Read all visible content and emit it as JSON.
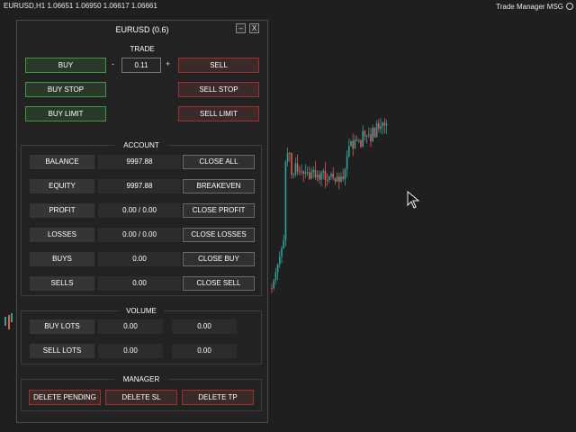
{
  "topbar": {
    "symbol_line": "EURUSD,H1  1.06651 1.06950 1.06617 1.06661",
    "right_label": "Trade Manager MSG"
  },
  "panel": {
    "title": "EURUSD (0.6)",
    "minimize": "–",
    "close": "X",
    "trade": {
      "title": "TRADE",
      "buy": "BUY",
      "minus": "-",
      "lot_value": "0.11",
      "plus": "+",
      "sell": "SELL",
      "buy_stop": "BUY STOP",
      "sell_stop": "SELL STOP",
      "buy_limit": "BUY LIMIT",
      "sell_limit": "SELL LIMIT"
    },
    "account": {
      "title": "ACCOUNT",
      "rows": [
        {
          "label": "BALANCE",
          "value": "9997.88",
          "button": "CLOSE ALL"
        },
        {
          "label": "EQUITY",
          "value": "9997.88",
          "button": "BREAKEVEN"
        },
        {
          "label": "PROFIT",
          "value": "0.00 / 0.00",
          "button": "CLOSE PROFIT"
        },
        {
          "label": "LOSSES",
          "value": "0.00 / 0.00",
          "button": "CLOSE LOSSES"
        },
        {
          "label": "BUYS",
          "value": "0.00",
          "button": "CLOSE BUY"
        },
        {
          "label": "SELLS",
          "value": "0.00",
          "button": "CLOSE SELL"
        }
      ]
    },
    "volume": {
      "title": "VOLUME",
      "rows": [
        {
          "label": "BUY LOTS",
          "value1": "0.00",
          "value2": "0.00"
        },
        {
          "label": "SELL LOTS",
          "value1": "0.00",
          "value2": "0.00"
        }
      ]
    },
    "manager": {
      "title": "MANAGER",
      "delete_pending": "DELETE PENDING",
      "delete_sl": "DELETE SL",
      "delete_tp": "DELETE TP"
    }
  },
  "colors": {
    "background": "#1f1f1f",
    "bull_candle": "#26a69a",
    "bear_candle": "#ef5350",
    "green_accent": "#3c9a3c",
    "red_accent": "#a03030",
    "blue_text": "#3a8fd8"
  },
  "icons": [
    "minimize-icon",
    "close-icon",
    "trade-manager-icon",
    "mouse-cursor-icon"
  ]
}
